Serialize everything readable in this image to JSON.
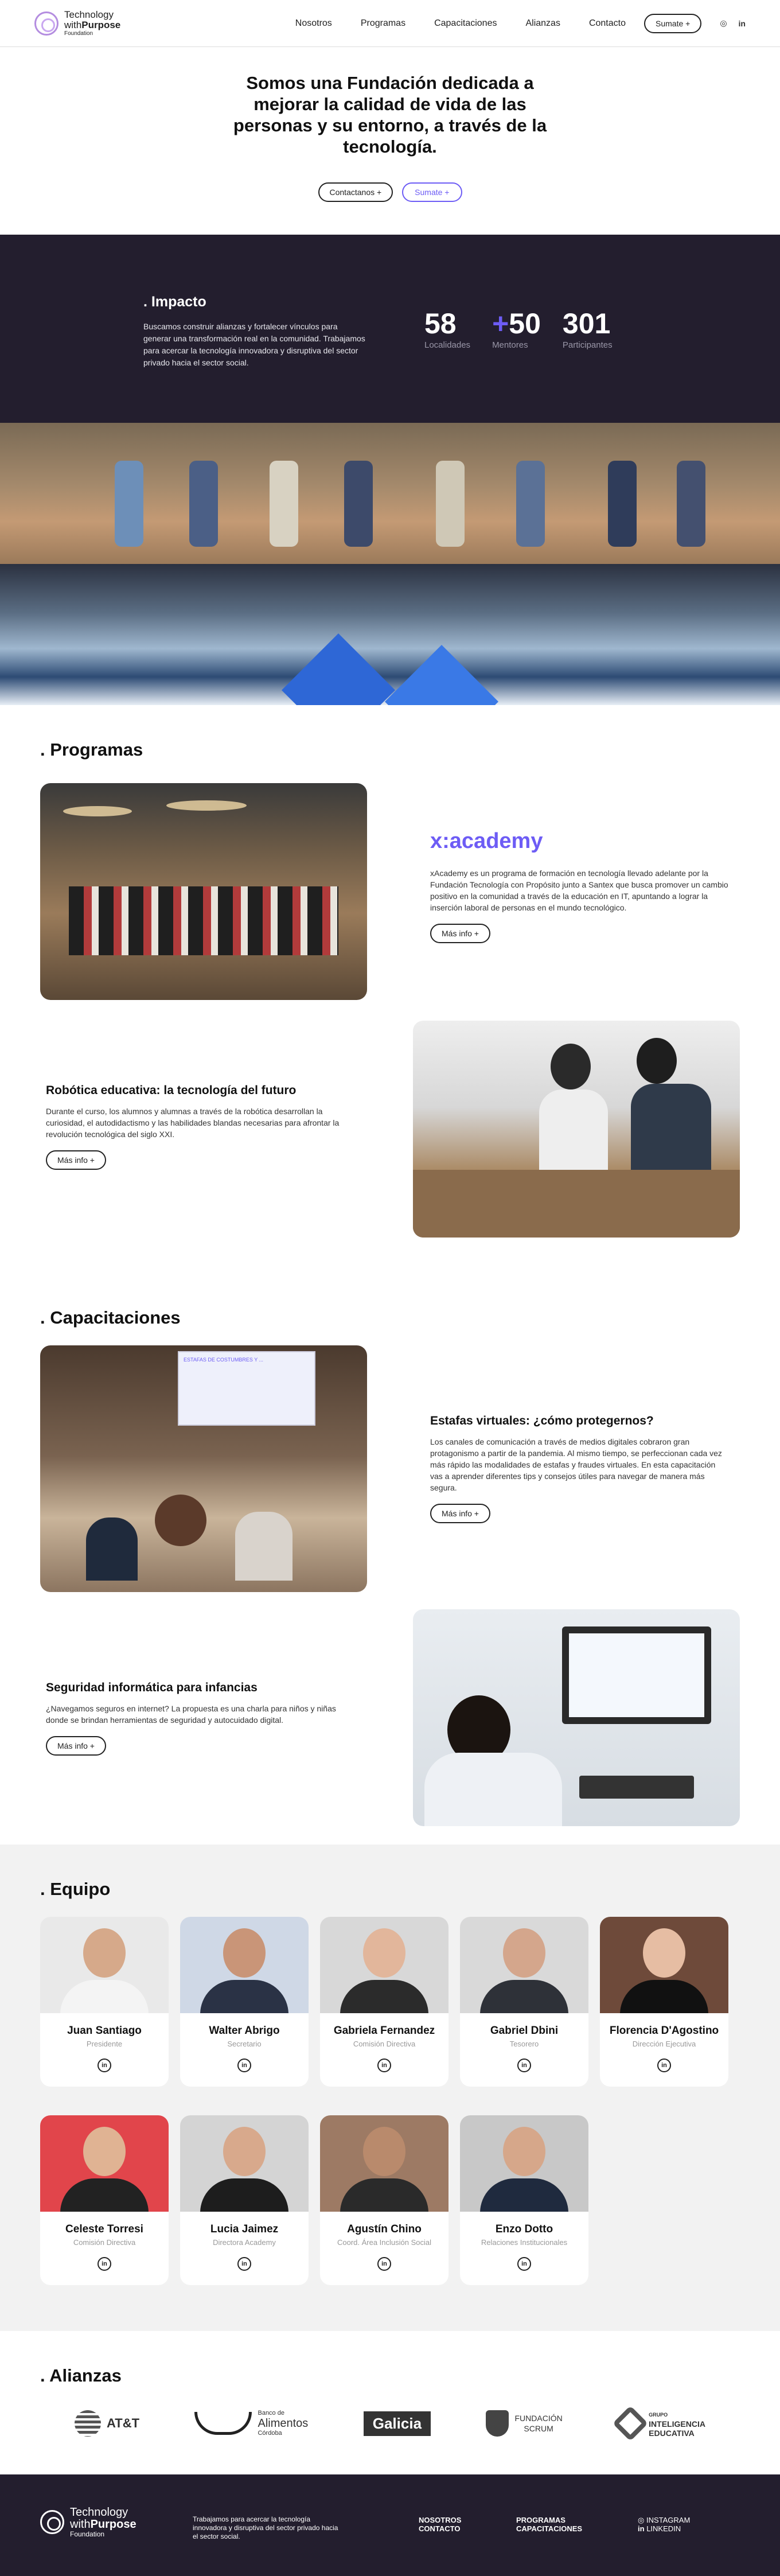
{
  "header": {
    "logo": {
      "line1": "Technology",
      "line2a": "with",
      "line2b": "Purpose",
      "line3": "Foundation"
    },
    "nav": [
      "Nosotros",
      "Programas",
      "Capacitaciones",
      "Alianzas",
      "Contacto"
    ],
    "cta": "Sumate +",
    "social": [
      "instagram-icon",
      "linkedin-icon"
    ],
    "social_glyphs": [
      "◎",
      "in"
    ]
  },
  "hero": {
    "title": "Somos una Fundación dedicada a mejorar la calidad de vida de las personas y su entorno, a través de la tecnología.",
    "btn_contact": "Contactanos +",
    "btn_join": "Sumate +"
  },
  "impact": {
    "title": ". Impacto",
    "text": "Buscamos construir alianzas y fortalecer vínculos para generar una transformación real en la comunidad. Trabajamos para acercar la tecnología innovadora y disruptiva del sector privado hacia el sector social.",
    "stats": [
      {
        "prefix": "",
        "value": "58",
        "label": "Localidades"
      },
      {
        "prefix": "+",
        "value": "50",
        "label": "Mentores"
      },
      {
        "prefix": "",
        "value": "301",
        "label": "Participantes"
      }
    ]
  },
  "programas": {
    "title": ". Programas",
    "xacademy": {
      "brand": "x:academy",
      "text": "xAcademy es un programa de formación en tecnología llevado adelante por la Fundación Tecnología con Propósito junto a Santex que busca promover un cambio positivo en la comunidad a través de la educación en IT, apuntando a lograr la inserción laboral de personas en el mundo tecnológico.",
      "btn": "Más info +"
    },
    "robotica": {
      "title": "Robótica educativa: la tecnología del futuro",
      "text": "Durante el curso, los alumnos y alumnas a través de la robótica desarrollan la curiosidad, el autodidactismo y las habilidades blandas necesarias para afrontar la revolución tecnológica del siglo XXI.",
      "btn": "Más info +"
    }
  },
  "capacitaciones": {
    "title": ". Capacitaciones",
    "slide_title": "ESTAFAS DE COSTUMBRES Y ...",
    "estafas": {
      "title": "Estafas virtuales: ¿cómo protegernos?",
      "text": "Los canales de comunicación a través de medios digitales cobraron gran protagonismo a partir de la pandemia. Al mismo tiempo, se perfeccionan cada vez más rápido las modalidades de estafas y fraudes virtuales. En esta capacitación vas a aprender diferentes tips y consejos útiles para navegar de manera más segura.",
      "btn": "Más info +"
    },
    "seguridad": {
      "title": "Seguridad informática para infancias",
      "text": "¿Navegamos seguros en internet? La propuesta es una charla para niños y niñas donde se brindan herramientas de seguridad y autocuidado digital.",
      "btn": "Más info +"
    }
  },
  "equipo": {
    "title": ". Equipo",
    "linkedin_glyph": "in",
    "members": [
      {
        "name": "Juan Santiago",
        "role": "Presidente",
        "bg": "#e9e9e9",
        "skin": "#d6a98a",
        "cloth": "#f4f4f4"
      },
      {
        "name": "Walter Abrigo",
        "role": "Secretario",
        "bg": "#cfd8e6",
        "skin": "#c99578",
        "cloth": "#2a3245"
      },
      {
        "name": "Gabriela Fernandez",
        "role": "Comisión Directiva",
        "bg": "#d8d8d8",
        "skin": "#e2b69b",
        "cloth": "#2b2b2b"
      },
      {
        "name": "Gabriel Dbini",
        "role": "Tesorero",
        "bg": "#d9d9d9",
        "skin": "#d4a68c",
        "cloth": "#2e3138"
      },
      {
        "name": "Florencia D'Agostino",
        "role": "Dirección Ejecutiva",
        "bg": "#6e4a3a",
        "skin": "#e6bda3",
        "cloth": "#111111"
      },
      {
        "name": "Celeste Torresi",
        "role": "Comisión Directiva",
        "bg": "#e1454b",
        "skin": "#e0b393",
        "cloth": "#222222"
      },
      {
        "name": "Lucia Jaimez",
        "role": "Directora Academy",
        "bg": "#d4d4d4",
        "skin": "#d8a98c",
        "cloth": "#1d1d1d"
      },
      {
        "name": "Agustín Chino",
        "role": "Coord. Área Inclusión Social",
        "bg": "#9d7a64",
        "skin": "#b98a6c",
        "cloth": "#2a2a2a"
      },
      {
        "name": "Enzo Dotto",
        "role": "Relaciones Institucionales",
        "bg": "#c8c8c8",
        "skin": "#d6a78a",
        "cloth": "#1f2a3e"
      }
    ]
  },
  "alianzas": {
    "title": ". Alianzas",
    "logos": [
      {
        "name": "AT&T",
        "icon": "att-logo"
      },
      {
        "name": "Banco de Alimentos Córdoba",
        "line1": "Banco de",
        "line2": "Alimentos",
        "line3": "Córdoba"
      },
      {
        "name": "Galicia",
        "text": "Galicia"
      },
      {
        "name": "Fundación Scrum",
        "line1": "FUNDACIÓN",
        "line2": "SCRUM"
      },
      {
        "name": "Grupo Inteligencia Educativa",
        "line1": "GRUPO",
        "line2": "INTELIGENCIA",
        "line3": "EDUCATIVA"
      }
    ]
  },
  "footer": {
    "text": "Trabajamos para acercar la tecnología innovadora y disruptiva del sector privado hacia el sector social.",
    "links1": [
      "NOSOTROS",
      "CONTACTO"
    ],
    "links2": [
      "PROGRAMAS",
      "CAPACITACIONES"
    ],
    "links3": [
      "INSTAGRAM",
      "LINKEDIN"
    ],
    "links3_glyphs": [
      "◎",
      "in"
    ]
  },
  "colors": {
    "accent": "#6d5cf5",
    "dark": "#231e2e",
    "team_bg": "#f2f2f2"
  }
}
